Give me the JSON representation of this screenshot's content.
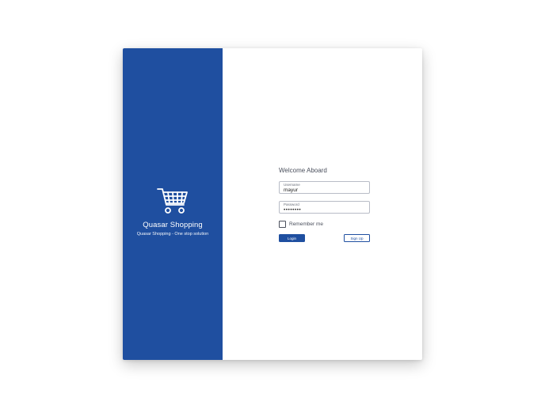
{
  "brand": {
    "title": "Quasar Shopping",
    "tagline": "Quasar Shopping - One stop solution",
    "icon": "shopping-cart-icon"
  },
  "form": {
    "welcome": "Welcome Aboard",
    "username": {
      "label": "Username",
      "value": "mayur"
    },
    "password": {
      "label": "Password",
      "value": "••••••••"
    },
    "remember_label": "Remember me",
    "remember_checked": false,
    "login_label": "Login",
    "signup_label": "Sign Up"
  },
  "colors": {
    "primary": "#1f4fa0",
    "text": "#4a4f5c"
  }
}
